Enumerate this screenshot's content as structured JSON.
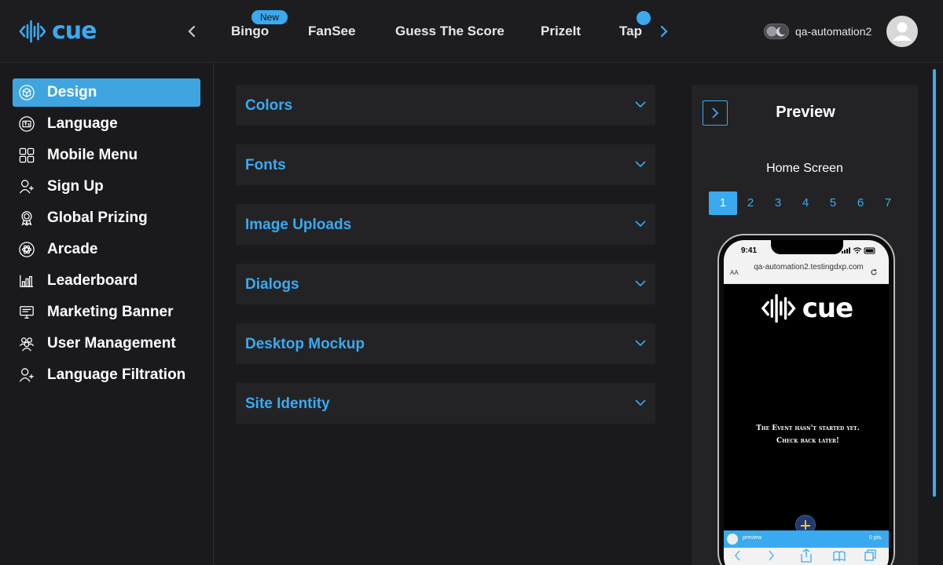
{
  "brand": {
    "logo_text": "cue",
    "accent": "#3aaaf0"
  },
  "topnav": {
    "tabs": [
      {
        "label": "Bingo",
        "badge": "New"
      },
      {
        "label": "FanSee"
      },
      {
        "label": "Guess The Score"
      },
      {
        "label": "PrizeIt"
      },
      {
        "label": "Tap"
      }
    ],
    "username": "qa-automation2"
  },
  "sidebar": {
    "items": [
      {
        "label": "Design",
        "icon": "cube-icon",
        "active": true
      },
      {
        "label": "Language",
        "icon": "language-icon"
      },
      {
        "label": "Mobile Menu",
        "icon": "grid-icon"
      },
      {
        "label": "Sign Up",
        "icon": "user-add-icon"
      },
      {
        "label": "Global Prizing",
        "icon": "award-icon"
      },
      {
        "label": "Arcade",
        "icon": "atom-icon"
      },
      {
        "label": "Leaderboard",
        "icon": "chart-icon"
      },
      {
        "label": "Marketing Banner",
        "icon": "monitor-icon"
      },
      {
        "label": "User Management",
        "icon": "users-icon"
      },
      {
        "label": "Language Filtration",
        "icon": "user-add-icon"
      }
    ]
  },
  "sections": [
    {
      "label": "Colors"
    },
    {
      "label": "Fonts"
    },
    {
      "label": "Image Uploads"
    },
    {
      "label": "Dialogs"
    },
    {
      "label": "Desktop Mockup"
    },
    {
      "label": "Site Identity"
    }
  ],
  "preview": {
    "title": "Preview",
    "screen_name": "Home Screen",
    "pages": [
      "1",
      "2",
      "3",
      "4",
      "5",
      "6",
      "7"
    ],
    "active_page": "1",
    "phone": {
      "time": "9:41",
      "url_aa": "AA",
      "url": "qa-automation2.testingdxp.com",
      "logo_text": "cue",
      "message": "The Event hasn't started yet. Check back later!",
      "footer_name": "preview",
      "footer_points": "0 pts."
    }
  }
}
